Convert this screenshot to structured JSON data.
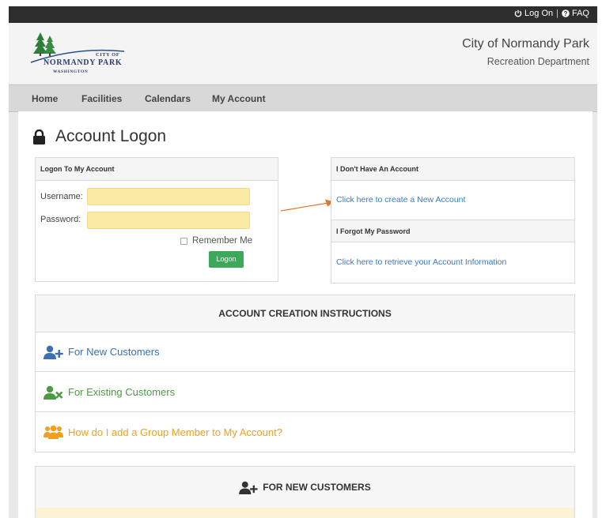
{
  "topbar": {
    "logon_label": "Log On",
    "separator": "|",
    "faq_label": "FAQ"
  },
  "header": {
    "logo": {
      "line1": "City of",
      "line2": "Normandy Park",
      "line3": "Washington"
    },
    "title": "City of Normandy Park",
    "subtitle": "Recreation Department"
  },
  "nav": {
    "items": [
      "Home",
      "Facilities",
      "Calendars",
      "My Account"
    ]
  },
  "page": {
    "title": "Account Logon"
  },
  "logon_box": {
    "heading": "Logon To My Account",
    "username_label": "Username:",
    "password_label": "Password:",
    "remember_label": "Remember Me",
    "logon_button": "Logon"
  },
  "no_account_box": {
    "heading": "I Don't Have An Account",
    "create_link": "Click here to create a New Account",
    "forgot_heading": "I Forgot My Password",
    "retrieve_link": "Click here to retrieve your Account Information"
  },
  "instructions": {
    "title": "ACCOUNT CREATION INSTRUCTIONS",
    "rows": [
      {
        "label": "For New Customers",
        "color": "#3a6fb5",
        "icon": "user-plus-icon"
      },
      {
        "label": "For Existing Customers",
        "color": "#4f9a45",
        "icon": "user-x-icon"
      },
      {
        "label": "How do I add a Group Member to My Account?",
        "color": "#f0a020",
        "icon": "group-icon"
      }
    ]
  },
  "new_customers": {
    "title": "FOR NEW CUSTOMERS",
    "icon": "user-plus-icon"
  },
  "colors": {
    "accent_button": "#3ea85a",
    "link": "#3a78c2",
    "arrow": "#e07b2e",
    "topbar": "#2e2e2e"
  }
}
